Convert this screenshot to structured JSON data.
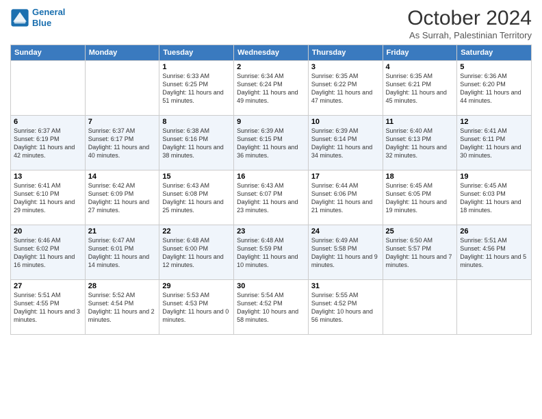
{
  "header": {
    "logo_line1": "General",
    "logo_line2": "Blue",
    "month": "October 2024",
    "location": "As Surrah, Palestinian Territory"
  },
  "days_of_week": [
    "Sunday",
    "Monday",
    "Tuesday",
    "Wednesday",
    "Thursday",
    "Friday",
    "Saturday"
  ],
  "weeks": [
    [
      {
        "day": "",
        "info": ""
      },
      {
        "day": "",
        "info": ""
      },
      {
        "day": "1",
        "info": "Sunrise: 6:33 AM\nSunset: 6:25 PM\nDaylight: 11 hours and 51 minutes."
      },
      {
        "day": "2",
        "info": "Sunrise: 6:34 AM\nSunset: 6:24 PM\nDaylight: 11 hours and 49 minutes."
      },
      {
        "day": "3",
        "info": "Sunrise: 6:35 AM\nSunset: 6:22 PM\nDaylight: 11 hours and 47 minutes."
      },
      {
        "day": "4",
        "info": "Sunrise: 6:35 AM\nSunset: 6:21 PM\nDaylight: 11 hours and 45 minutes."
      },
      {
        "day": "5",
        "info": "Sunrise: 6:36 AM\nSunset: 6:20 PM\nDaylight: 11 hours and 44 minutes."
      }
    ],
    [
      {
        "day": "6",
        "info": "Sunrise: 6:37 AM\nSunset: 6:19 PM\nDaylight: 11 hours and 42 minutes."
      },
      {
        "day": "7",
        "info": "Sunrise: 6:37 AM\nSunset: 6:17 PM\nDaylight: 11 hours and 40 minutes."
      },
      {
        "day": "8",
        "info": "Sunrise: 6:38 AM\nSunset: 6:16 PM\nDaylight: 11 hours and 38 minutes."
      },
      {
        "day": "9",
        "info": "Sunrise: 6:39 AM\nSunset: 6:15 PM\nDaylight: 11 hours and 36 minutes."
      },
      {
        "day": "10",
        "info": "Sunrise: 6:39 AM\nSunset: 6:14 PM\nDaylight: 11 hours and 34 minutes."
      },
      {
        "day": "11",
        "info": "Sunrise: 6:40 AM\nSunset: 6:13 PM\nDaylight: 11 hours and 32 minutes."
      },
      {
        "day": "12",
        "info": "Sunrise: 6:41 AM\nSunset: 6:11 PM\nDaylight: 11 hours and 30 minutes."
      }
    ],
    [
      {
        "day": "13",
        "info": "Sunrise: 6:41 AM\nSunset: 6:10 PM\nDaylight: 11 hours and 29 minutes."
      },
      {
        "day": "14",
        "info": "Sunrise: 6:42 AM\nSunset: 6:09 PM\nDaylight: 11 hours and 27 minutes."
      },
      {
        "day": "15",
        "info": "Sunrise: 6:43 AM\nSunset: 6:08 PM\nDaylight: 11 hours and 25 minutes."
      },
      {
        "day": "16",
        "info": "Sunrise: 6:43 AM\nSunset: 6:07 PM\nDaylight: 11 hours and 23 minutes."
      },
      {
        "day": "17",
        "info": "Sunrise: 6:44 AM\nSunset: 6:06 PM\nDaylight: 11 hours and 21 minutes."
      },
      {
        "day": "18",
        "info": "Sunrise: 6:45 AM\nSunset: 6:05 PM\nDaylight: 11 hours and 19 minutes."
      },
      {
        "day": "19",
        "info": "Sunrise: 6:45 AM\nSunset: 6:03 PM\nDaylight: 11 hours and 18 minutes."
      }
    ],
    [
      {
        "day": "20",
        "info": "Sunrise: 6:46 AM\nSunset: 6:02 PM\nDaylight: 11 hours and 16 minutes."
      },
      {
        "day": "21",
        "info": "Sunrise: 6:47 AM\nSunset: 6:01 PM\nDaylight: 11 hours and 14 minutes."
      },
      {
        "day": "22",
        "info": "Sunrise: 6:48 AM\nSunset: 6:00 PM\nDaylight: 11 hours and 12 minutes."
      },
      {
        "day": "23",
        "info": "Sunrise: 6:48 AM\nSunset: 5:59 PM\nDaylight: 11 hours and 10 minutes."
      },
      {
        "day": "24",
        "info": "Sunrise: 6:49 AM\nSunset: 5:58 PM\nDaylight: 11 hours and 9 minutes."
      },
      {
        "day": "25",
        "info": "Sunrise: 6:50 AM\nSunset: 5:57 PM\nDaylight: 11 hours and 7 minutes."
      },
      {
        "day": "26",
        "info": "Sunrise: 5:51 AM\nSunset: 4:56 PM\nDaylight: 11 hours and 5 minutes."
      }
    ],
    [
      {
        "day": "27",
        "info": "Sunrise: 5:51 AM\nSunset: 4:55 PM\nDaylight: 11 hours and 3 minutes."
      },
      {
        "day": "28",
        "info": "Sunrise: 5:52 AM\nSunset: 4:54 PM\nDaylight: 11 hours and 2 minutes."
      },
      {
        "day": "29",
        "info": "Sunrise: 5:53 AM\nSunset: 4:53 PM\nDaylight: 11 hours and 0 minutes."
      },
      {
        "day": "30",
        "info": "Sunrise: 5:54 AM\nSunset: 4:52 PM\nDaylight: 10 hours and 58 minutes."
      },
      {
        "day": "31",
        "info": "Sunrise: 5:55 AM\nSunset: 4:52 PM\nDaylight: 10 hours and 56 minutes."
      },
      {
        "day": "",
        "info": ""
      },
      {
        "day": "",
        "info": ""
      }
    ]
  ]
}
